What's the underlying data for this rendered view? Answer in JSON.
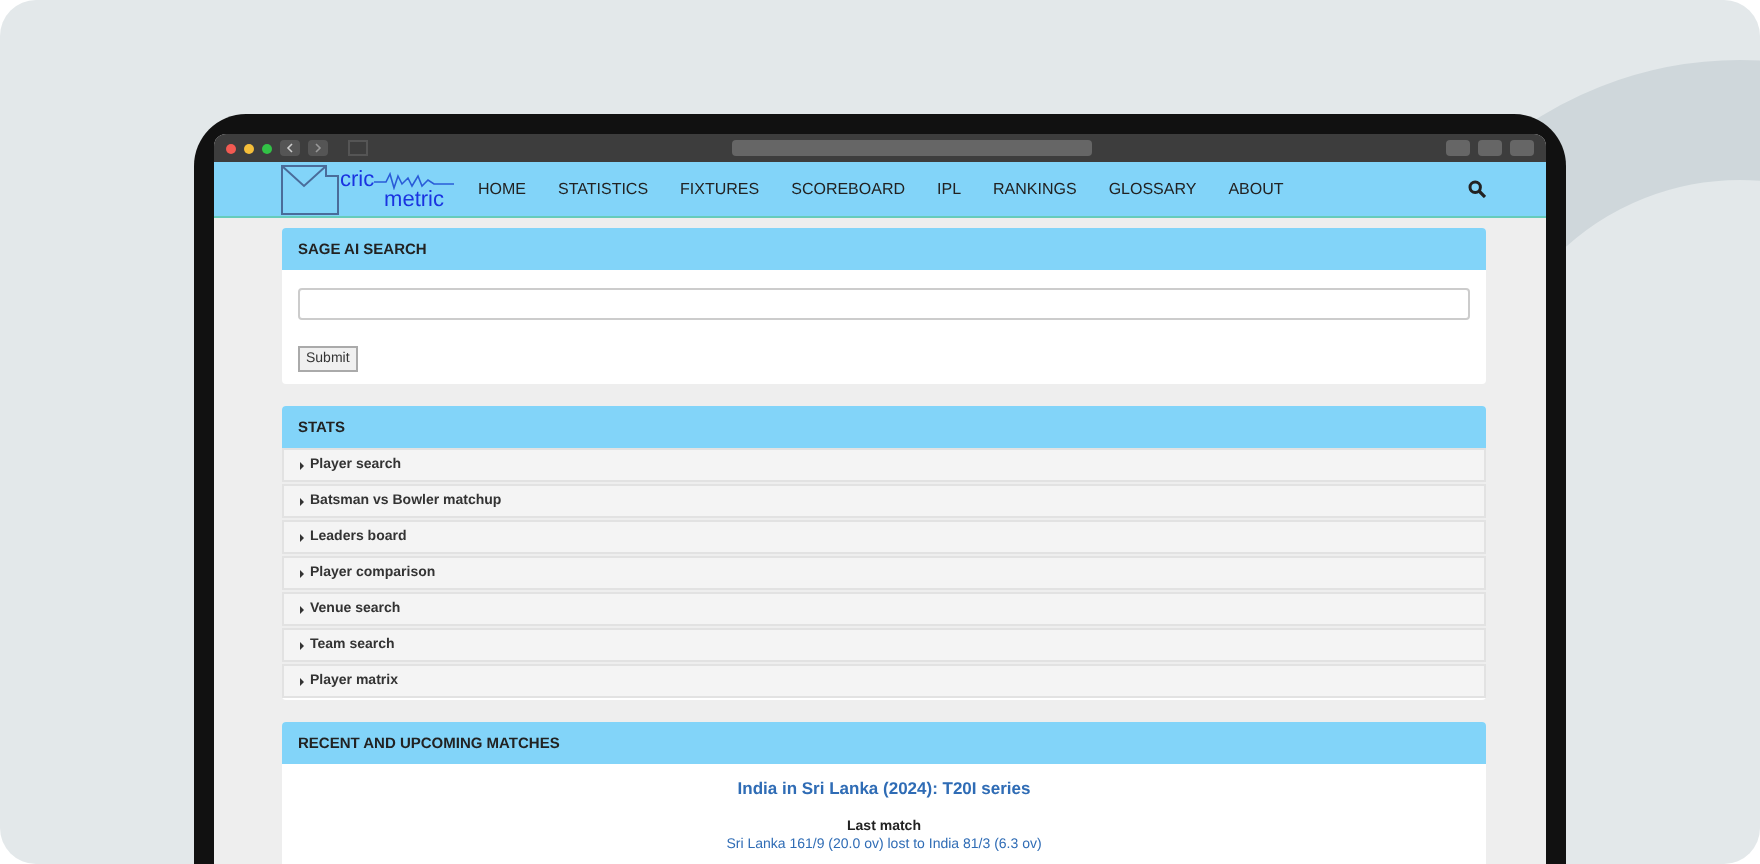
{
  "nav": {
    "logo_top": "cric",
    "logo_bottom": "metric",
    "items": [
      "HOME",
      "STATISTICS",
      "FIXTURES",
      "SCOREBOARD",
      "IPL",
      "RANKINGS",
      "GLOSSARY",
      "ABOUT"
    ]
  },
  "sage_search": {
    "title": "SAGE AI SEARCH",
    "button": "Submit"
  },
  "stats": {
    "title": "STATS",
    "items": [
      {
        "label": "Player search",
        "expanded": false
      },
      {
        "label": "Batsman vs Bowler matchup",
        "expanded": false
      },
      {
        "label": "Leaders board",
        "expanded": false
      },
      {
        "label": "Player comparison",
        "expanded": false
      },
      {
        "label": "Venue search",
        "expanded": false
      },
      {
        "label": "Team search",
        "expanded": false
      },
      {
        "label": "Player matrix",
        "expanded": false
      }
    ]
  },
  "matches": {
    "title": "RECENT AND UPCOMING MATCHES",
    "series": "India in Sri Lanka (2024): T20I series",
    "last_match_label": "Last match",
    "last_match_result": "Sri Lanka 161/9 (20.0 ov) lost to India 81/3 (6.3 ov)"
  }
}
